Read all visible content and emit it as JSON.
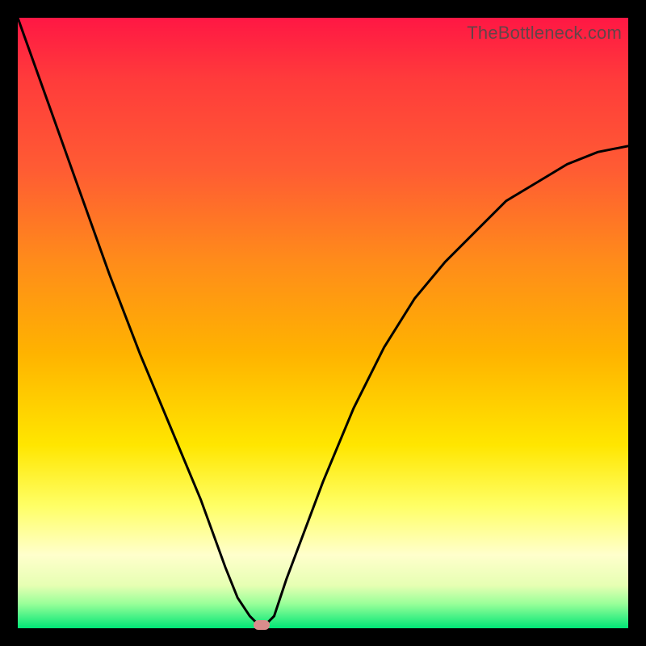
{
  "watermark": "TheBottleneck.com",
  "chart_data": {
    "type": "line",
    "title": "",
    "xlabel": "",
    "ylabel": "",
    "x": [
      0.0,
      0.05,
      0.1,
      0.15,
      0.2,
      0.25,
      0.3,
      0.34,
      0.36,
      0.38,
      0.4,
      0.42,
      0.44,
      0.5,
      0.55,
      0.6,
      0.65,
      0.7,
      0.75,
      0.8,
      0.85,
      0.9,
      0.95,
      1.0
    ],
    "values": [
      1.0,
      0.86,
      0.72,
      0.58,
      0.45,
      0.33,
      0.21,
      0.1,
      0.05,
      0.02,
      0.0,
      0.02,
      0.08,
      0.24,
      0.36,
      0.46,
      0.54,
      0.6,
      0.65,
      0.7,
      0.73,
      0.76,
      0.78,
      0.79
    ],
    "ylim": [
      0,
      1
    ],
    "xlim": [
      0,
      1
    ],
    "marker": {
      "x": 0.4,
      "y": 0.0
    },
    "gradient_colors": [
      "#ff1744",
      "#ff8c1a",
      "#ffe600",
      "#00e676"
    ]
  }
}
